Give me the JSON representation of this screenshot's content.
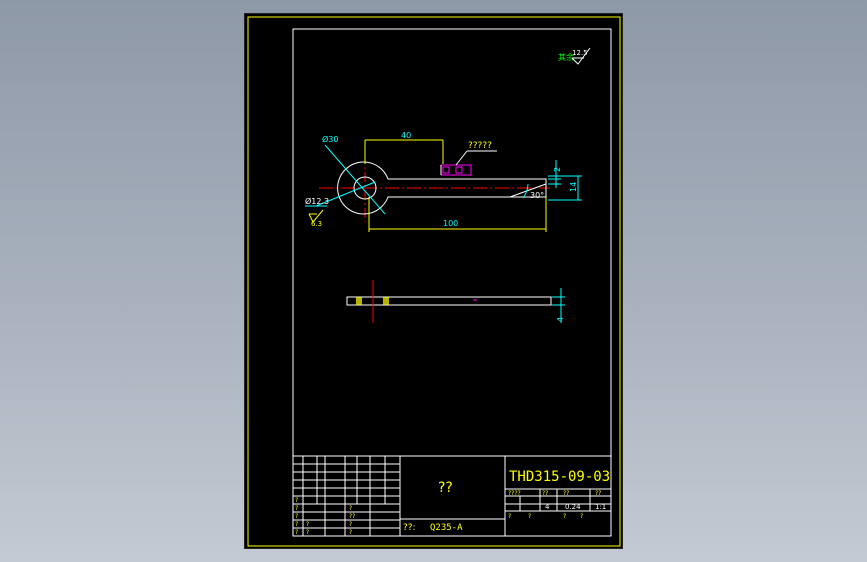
{
  "drawing": {
    "roughness_symbol": "12.5",
    "roughness_note": "其余",
    "dims": {
      "d_outer": "Ø30",
      "d_hole": "Ø12.3",
      "hole_roughness": "6.3",
      "len_40": "40",
      "len_100": "100",
      "gap_2": "2",
      "width_14": "14",
      "angle_30": "30°",
      "thickness_4": "4",
      "weld_note": "?????"
    }
  },
  "title_block": {
    "part_name": "??",
    "drawing_no": "THD315-09-03",
    "material_label": "??:",
    "material": "Q235-A",
    "scale_headers": [
      "????",
      "??",
      "??",
      "??"
    ],
    "scale_values": [
      "",
      "4",
      "0.24",
      "1:1"
    ],
    "sheet_row": [
      "?",
      "?",
      "?",
      "?"
    ],
    "left_q": [
      "?",
      "?",
      "?",
      "?",
      "?",
      "?",
      "?"
    ],
    "sig_marks": [
      "?",
      "??",
      "?",
      "?"
    ]
  },
  "colors": {
    "frame": "#ffff00",
    "line": "#ffffff",
    "dim": "#00ffff",
    "center": "#ff0000",
    "magenta": "#ff00ff",
    "green": "#00ff00"
  }
}
